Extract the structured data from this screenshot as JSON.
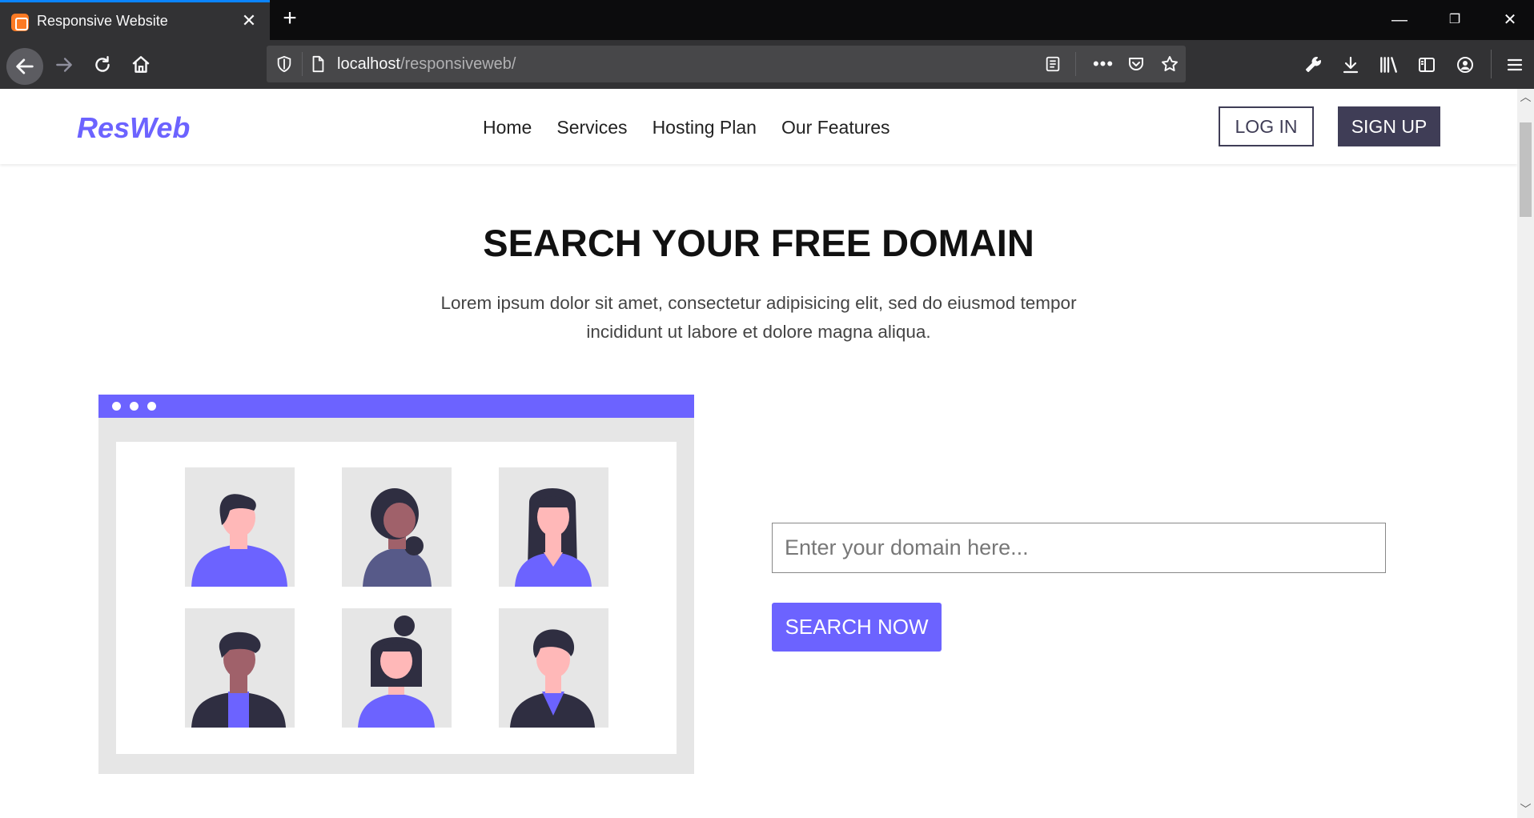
{
  "browser": {
    "tab_title": "Responsive Website",
    "url_host": "localhost",
    "url_path": "/responsiveweb/"
  },
  "site": {
    "logo": "ResWeb",
    "nav": [
      "Home",
      "Services",
      "Hosting Plan",
      "Our Features"
    ],
    "login_label": "LOG IN",
    "signup_label": "SIGN UP"
  },
  "hero": {
    "title": "SEARCH YOUR FREE DOMAIN",
    "subtitle_line1": "Lorem ipsum dolor sit amet, consectetur adipisicing elit, sed do eiusmod tempor",
    "subtitle_line2": "incididunt ut labore et dolore magna aliqua."
  },
  "search": {
    "placeholder": "Enter your domain here...",
    "button_label": "SEARCH NOW"
  },
  "colors": {
    "accent": "#6c63ff",
    "dark": "#3f3d56"
  }
}
